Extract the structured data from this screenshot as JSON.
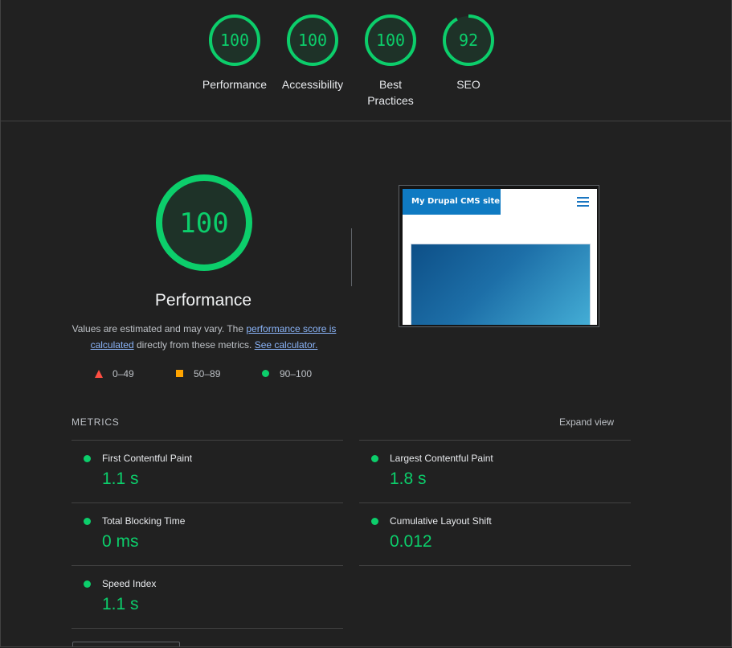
{
  "header": {
    "gauges": [
      {
        "label": "Performance",
        "score": "100",
        "value": 100
      },
      {
        "label": "Accessibility",
        "score": "100",
        "value": 100
      },
      {
        "label": "Best Practices",
        "score": "100",
        "value": 100
      },
      {
        "label": "SEO",
        "score": "92",
        "value": 92
      }
    ]
  },
  "performance": {
    "score": "100",
    "value": 100,
    "title": "Performance",
    "desc_part1": "Values are estimated and may vary. The ",
    "link_score": "performance score is calculated",
    "desc_part2": " directly from these metrics. ",
    "link_calc": "See calculator."
  },
  "legend": {
    "fail": "0–49",
    "average": "50–89",
    "pass": "90–100"
  },
  "screenshot": {
    "site_title": "My Drupal CMS site"
  },
  "metrics": {
    "header": "METRICS",
    "expand_label": "Expand view",
    "items": [
      {
        "label": "First Contentful Paint",
        "value": "1.1 s"
      },
      {
        "label": "Largest Contentful Paint",
        "value": "1.8 s"
      },
      {
        "label": "Total Blocking Time",
        "value": "0 ms"
      },
      {
        "label": "Cumulative Layout Shift",
        "value": "0.012"
      },
      {
        "label": "Speed Index",
        "value": "1.1 s"
      }
    ]
  },
  "colors": {
    "pass": "#0cce6b",
    "average": "#ffa400",
    "fail": "#ff4e42",
    "link": "#8ab4f8",
    "background": "#212121"
  }
}
